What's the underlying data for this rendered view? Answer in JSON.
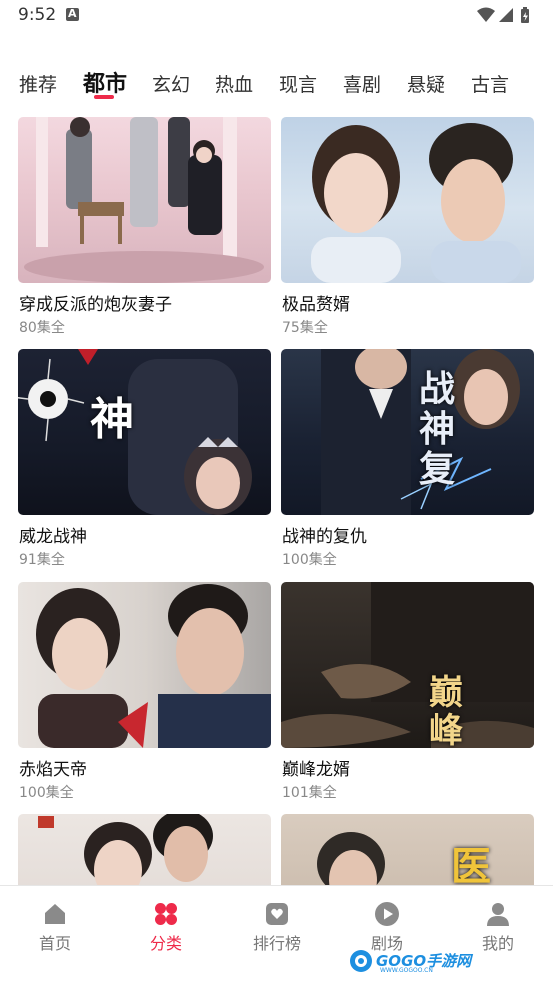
{
  "status_bar": {
    "time": "9:52"
  },
  "tabs": [
    {
      "label": "推荐",
      "active": false
    },
    {
      "label": "都市",
      "active": true
    },
    {
      "label": "玄幻",
      "active": false
    },
    {
      "label": "热血",
      "active": false
    },
    {
      "label": "现言",
      "active": false
    },
    {
      "label": "喜剧",
      "active": false
    },
    {
      "label": "悬疑",
      "active": false
    },
    {
      "label": "古言",
      "active": false
    }
  ],
  "cards": [
    {
      "title": "穿成反派的炮灰妻子",
      "episodes": "80集全"
    },
    {
      "title": "极品赘婿",
      "episodes": "75集全"
    },
    {
      "title": "威龙战神",
      "episodes": "91集全"
    },
    {
      "title": "战神的复仇",
      "episodes": "100集全"
    },
    {
      "title": "赤焰天帝",
      "episodes": "100集全"
    },
    {
      "title": "巅峰龙婿",
      "episodes": "101集全"
    },
    {
      "title": "",
      "episodes": ""
    },
    {
      "title": "",
      "episodes": ""
    }
  ],
  "covers": {
    "c2_text": "神",
    "c3_text": "战神复",
    "c5_text": "巅峰",
    "c7_text": "医"
  },
  "bottom_nav": [
    {
      "label": "首页",
      "icon": "home-icon",
      "active": false
    },
    {
      "label": "分类",
      "icon": "category-icon",
      "active": true
    },
    {
      "label": "排行榜",
      "icon": "ranking-icon",
      "active": false
    },
    {
      "label": "剧场",
      "icon": "theater-play-icon",
      "active": false
    },
    {
      "label": "我的",
      "icon": "profile-icon",
      "active": false
    }
  ],
  "watermark": {
    "text": "GOGO手游网",
    "sub": "WWW.GOGOO.CN"
  },
  "colors": {
    "accent": "#ee2a4a",
    "inactive": "#777777"
  }
}
